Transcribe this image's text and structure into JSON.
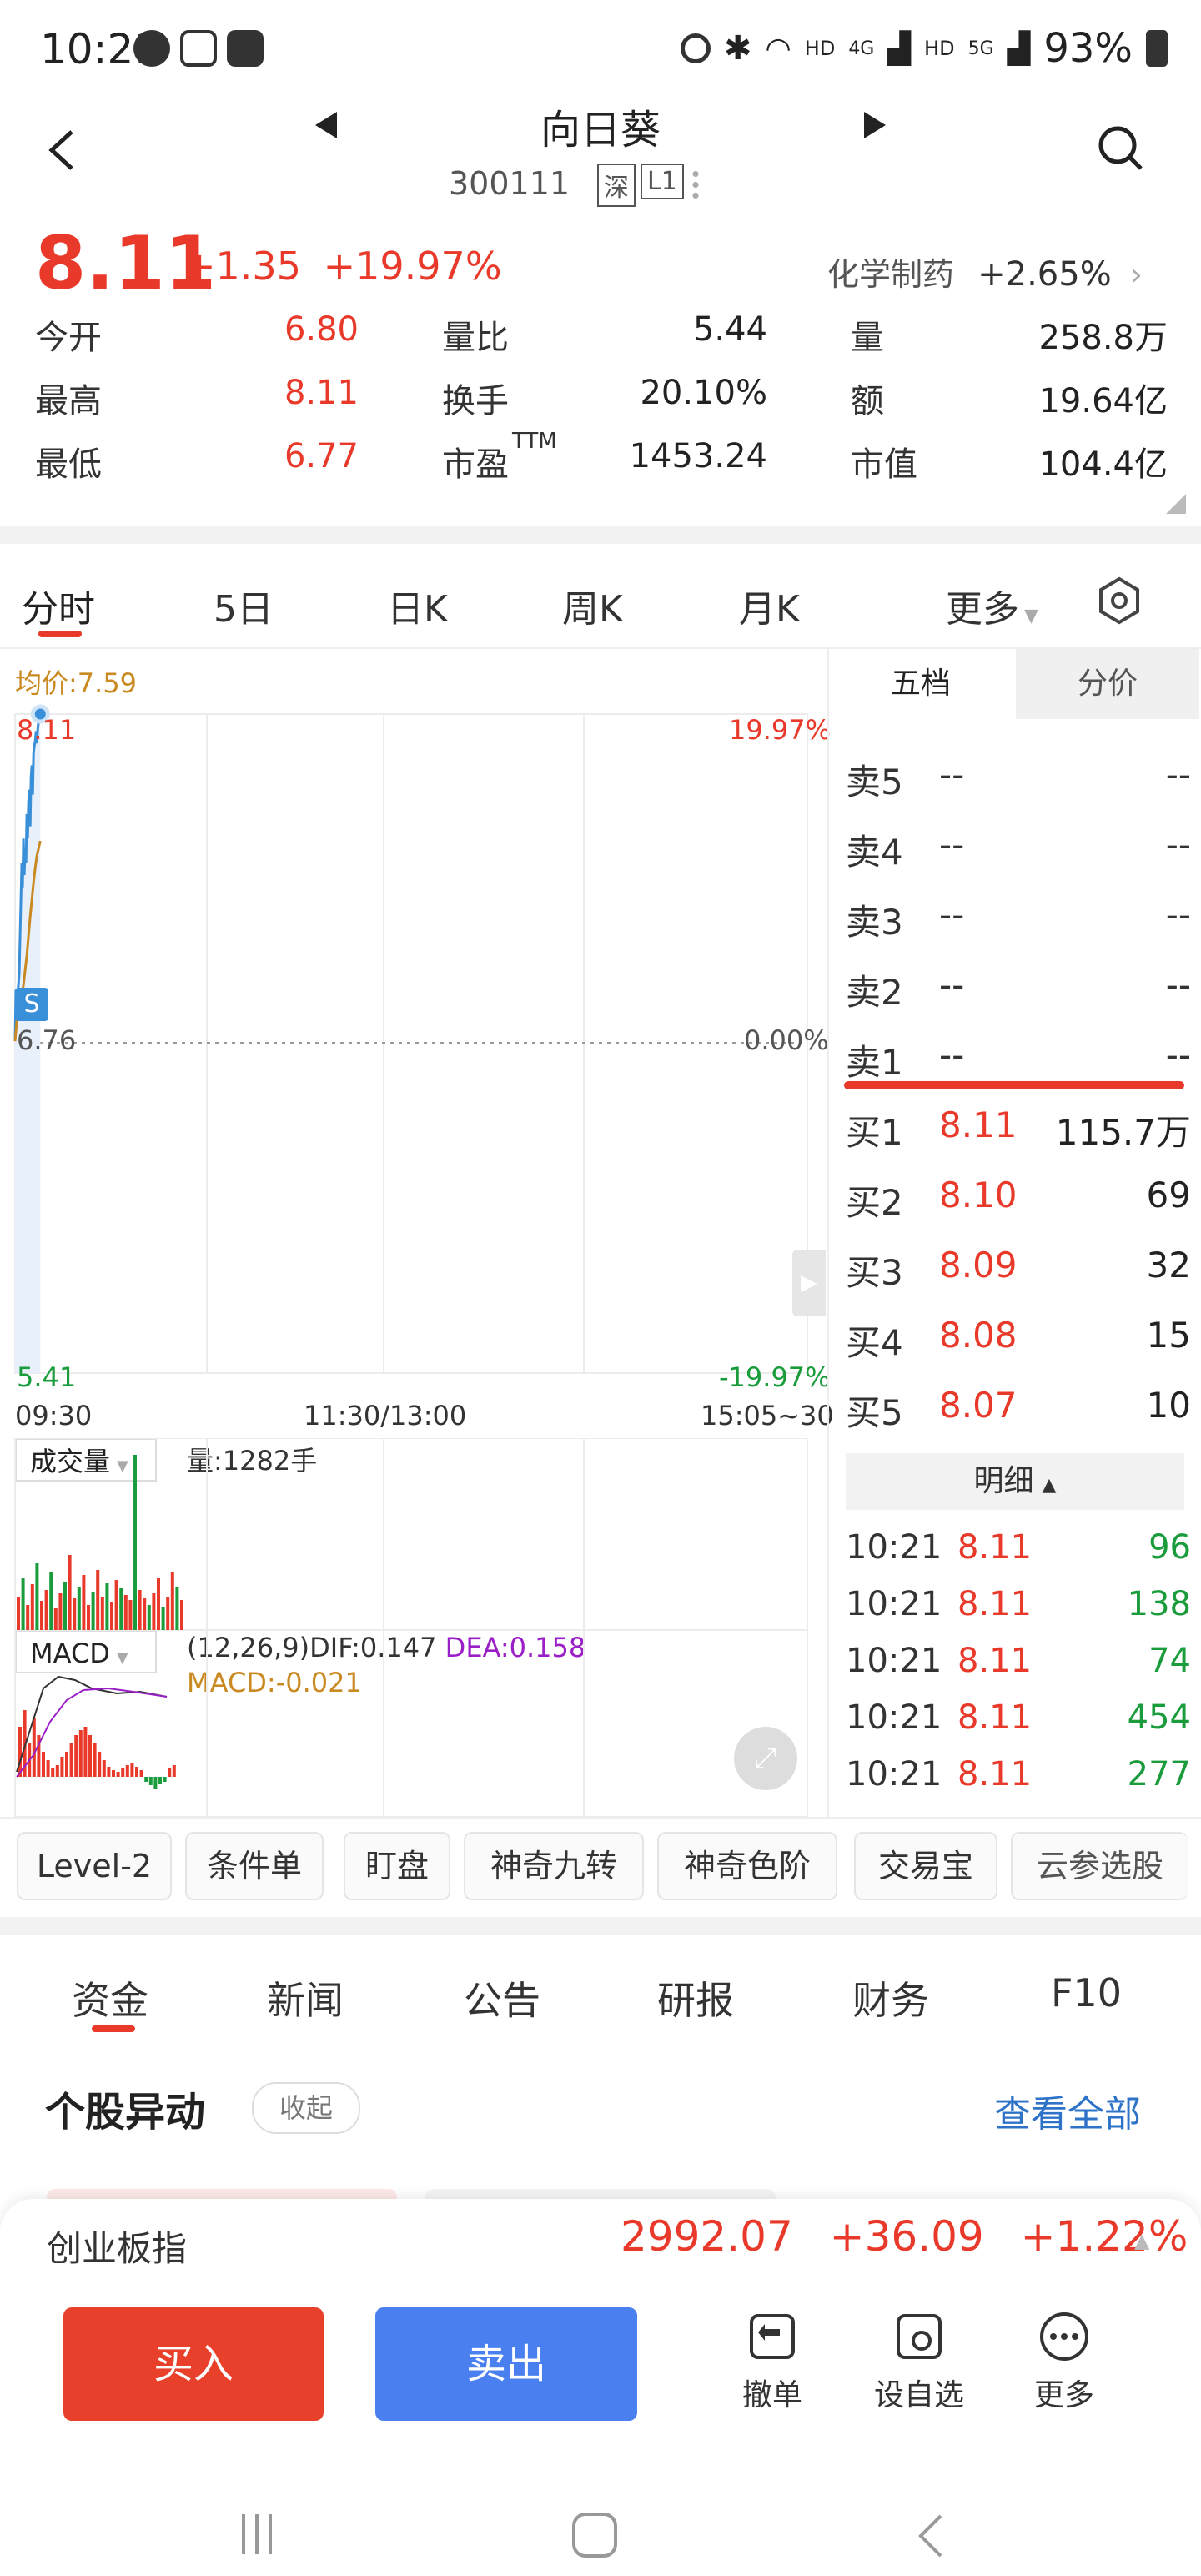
{
  "status_bar": {
    "time": "10:21",
    "battery": "93%",
    "signal_labels": [
      "HD",
      "4G",
      "HD",
      "5G"
    ]
  },
  "header": {
    "name": "向日葵",
    "code": "300111",
    "market_tag": "深",
    "level_tag": "L1"
  },
  "quote": {
    "price": "8.11",
    "change": "+1.35",
    "change_pct": "+19.97%",
    "sector": {
      "name": "化学制药",
      "change": "+2.65%"
    },
    "rows": [
      [
        {
          "label": "今开",
          "value": "6.80",
          "color": "red"
        },
        {
          "label": "量比",
          "value": "5.44",
          "color": "dark"
        },
        {
          "label": "量",
          "value": "258.8万",
          "color": "dark"
        }
      ],
      [
        {
          "label": "最高",
          "value": "8.11",
          "color": "red"
        },
        {
          "label": "换手",
          "value": "20.10%",
          "color": "dark"
        },
        {
          "label": "额",
          "value": "19.64亿",
          "color": "dark"
        }
      ],
      [
        {
          "label": "最低",
          "value": "6.77",
          "color": "red"
        },
        {
          "label": "市盈",
          "label_sup": "TTM",
          "value": "1453.24",
          "color": "dark"
        },
        {
          "label": "市值",
          "value": "104.4亿",
          "color": "dark"
        }
      ]
    ]
  },
  "chart_tabs": [
    "分时",
    "5日",
    "日K",
    "周K",
    "月K",
    "更多"
  ],
  "chart": {
    "avg_price_label": "均价:7.59",
    "y_top": "8.11",
    "y_mid": "6.76",
    "y_bottom": "5.41",
    "pct_top": "19.97%",
    "pct_mid": "0.00%",
    "pct_bottom": "-19.97%",
    "x_labels": [
      "09:30",
      "11:30/13:00",
      "15:05~30"
    ],
    "marker": "S",
    "volume_selector": "成交量",
    "volume_label": "量:1282手",
    "macd_selector": "MACD",
    "macd_params": "(12,26,9)",
    "dif": "DIF:0.147",
    "dea": "DEA:0.158",
    "macd": "MACD:-0.021"
  },
  "chart_data": {
    "type": "line",
    "series": [
      {
        "name": "price",
        "color": "#3a8fd9",
        "x": [
          0,
          1,
          2,
          3,
          4,
          5,
          6,
          7,
          8,
          9,
          10,
          11,
          12,
          13,
          14,
          15,
          16,
          17,
          18,
          19,
          20,
          21,
          22,
          23,
          24,
          25,
          26,
          27,
          28,
          29,
          30
        ],
        "values": [
          6.77,
          6.98,
          6.85,
          6.95,
          7.0,
          7.05,
          7.2,
          7.35,
          7.5,
          7.4,
          7.6,
          7.45,
          7.55,
          7.5,
          7.7,
          7.6,
          7.75,
          7.8,
          7.65,
          7.85,
          7.9,
          7.78,
          7.95,
          7.98,
          8.0,
          8.04,
          7.99,
          8.05,
          8.08,
          8.1,
          8.11
        ]
      },
      {
        "name": "均价",
        "color": "#c98a22",
        "x": [
          0,
          2,
          4,
          6,
          8,
          10,
          12,
          14,
          16,
          18,
          20,
          22,
          24,
          26,
          28,
          30
        ],
        "values": [
          6.77,
          6.85,
          6.88,
          6.9,
          6.95,
          7.0,
          7.06,
          7.12,
          7.2,
          7.28,
          7.35,
          7.42,
          7.48,
          7.53,
          7.56,
          7.59
        ]
      }
    ],
    "ylim": [
      5.41,
      8.11
    ],
    "x_total": 240
  },
  "book": {
    "tabs": [
      "五档",
      "分价"
    ],
    "sell": [
      {
        "label": "卖5",
        "price": "--",
        "vol": "--"
      },
      {
        "label": "卖4",
        "price": "--",
        "vol": "--"
      },
      {
        "label": "卖3",
        "price": "--",
        "vol": "--"
      },
      {
        "label": "卖2",
        "price": "--",
        "vol": "--"
      },
      {
        "label": "卖1",
        "price": "--",
        "vol": "--"
      }
    ],
    "buy": [
      {
        "label": "买1",
        "price": "8.11",
        "vol": "115.7万"
      },
      {
        "label": "买2",
        "price": "8.10",
        "vol": "69"
      },
      {
        "label": "买3",
        "price": "8.09",
        "vol": "32"
      },
      {
        "label": "买4",
        "price": "8.08",
        "vol": "15"
      },
      {
        "label": "买5",
        "price": "8.07",
        "vol": "10"
      }
    ],
    "detail_label": "明细",
    "ticks": [
      {
        "time": "10:21",
        "price": "8.11",
        "vol": "96"
      },
      {
        "time": "10:21",
        "price": "8.11",
        "vol": "138"
      },
      {
        "time": "10:21",
        "price": "8.11",
        "vol": "74"
      },
      {
        "time": "10:21",
        "price": "8.11",
        "vol": "454"
      },
      {
        "time": "10:21",
        "price": "8.11",
        "vol": "277"
      }
    ]
  },
  "tools": [
    "Level-2",
    "条件单",
    "盯盘",
    "神奇九转",
    "神奇色阶",
    "交易宝",
    "云参选股"
  ],
  "info_tabs": [
    "资金",
    "新闻",
    "公告",
    "研报",
    "财务",
    "F10"
  ],
  "section": {
    "title": "个股异动",
    "collapse": "收起",
    "view_all": "查看全部"
  },
  "bottom": {
    "index_name": "创业板指",
    "index_value": "2992.07",
    "index_change": "+36.09",
    "index_pct": "+1.22%",
    "buy": "买入",
    "sell": "卖出",
    "actions": [
      "撤单",
      "设自选",
      "更多"
    ]
  }
}
